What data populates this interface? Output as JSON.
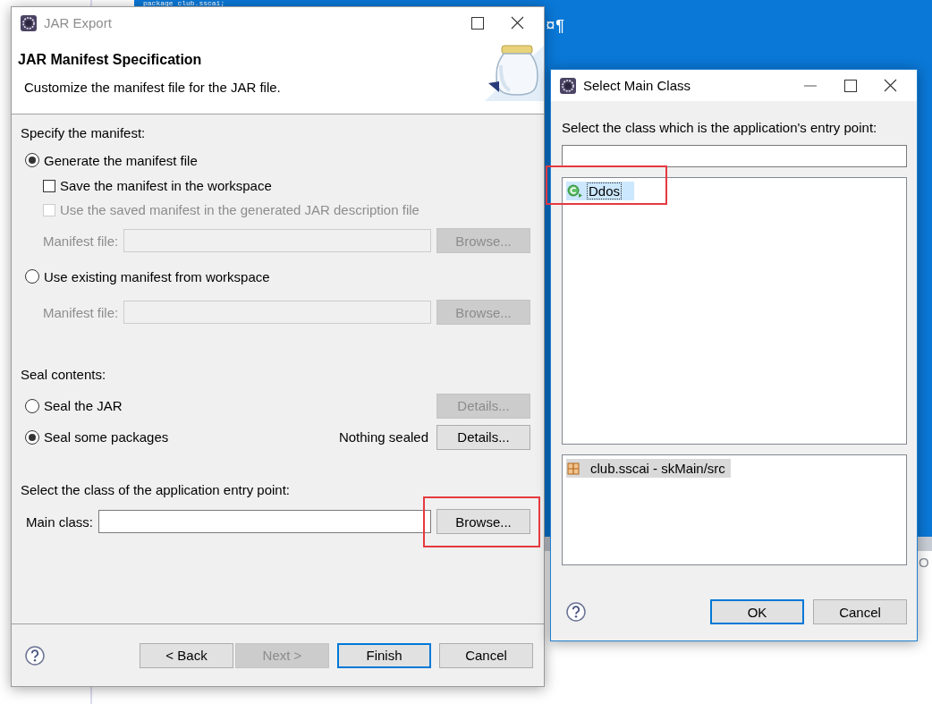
{
  "background": {
    "code": [
      "package club.sscai;",
      "¤¶"
    ],
    "fragment": "O"
  },
  "jar_export": {
    "title": "JAR Export",
    "heading": "JAR Manifest Specification",
    "description": "Customize the manifest file for the JAR file.",
    "manifest": {
      "label": "Specify the manifest:",
      "items": [
        {
          "kind": "radio",
          "label": "Generate the manifest file",
          "selected": true
        },
        {
          "kind": "checkbox",
          "label": "Save the manifest in the workspace",
          "checked": false,
          "disabled": false
        },
        {
          "kind": "checkbox",
          "label": "Use the saved manifest in the generated JAR description file",
          "checked": false,
          "disabled": true
        },
        {
          "kind": "file",
          "label": "Manifest file:",
          "button": "Browse...",
          "disabled": true
        },
        {
          "kind": "radio",
          "label": "Use existing manifest from workspace",
          "selected": false
        },
        {
          "kind": "file",
          "label": "Manifest file:",
          "button": "Browse...",
          "disabled": true
        }
      ]
    },
    "seal": {
      "label": "Seal contents:",
      "options": [
        {
          "label": "Seal the JAR",
          "selected": false,
          "button": "Details...",
          "disabled": true
        },
        {
          "label": "Seal some packages",
          "selected": true,
          "status": "Nothing sealed",
          "button": "Details...",
          "disabled": false
        }
      ]
    },
    "entry": {
      "label": "Select the class of the application entry point:",
      "field_label": "Main class:",
      "button": "Browse...",
      "highlighted": true
    },
    "buttons": [
      {
        "label": "< Back",
        "disabled": false,
        "default": false
      },
      {
        "label": "Next >",
        "disabled": true,
        "default": false
      },
      {
        "label": "Finish",
        "disabled": false,
        "default": true
      },
      {
        "label": "Cancel",
        "disabled": false,
        "default": false
      }
    ]
  },
  "select_main_class": {
    "title": "Select Main Class",
    "prompt": "Select the class which is the application's entry point:",
    "matches": [
      {
        "label": "Ddos",
        "selected": true,
        "highlighted": true
      }
    ],
    "packages": [
      {
        "label": "club.sscai - skMain/src",
        "selected": true
      }
    ],
    "buttons": [
      {
        "label": "OK",
        "default": true
      },
      {
        "label": "Cancel",
        "default": false
      }
    ]
  }
}
